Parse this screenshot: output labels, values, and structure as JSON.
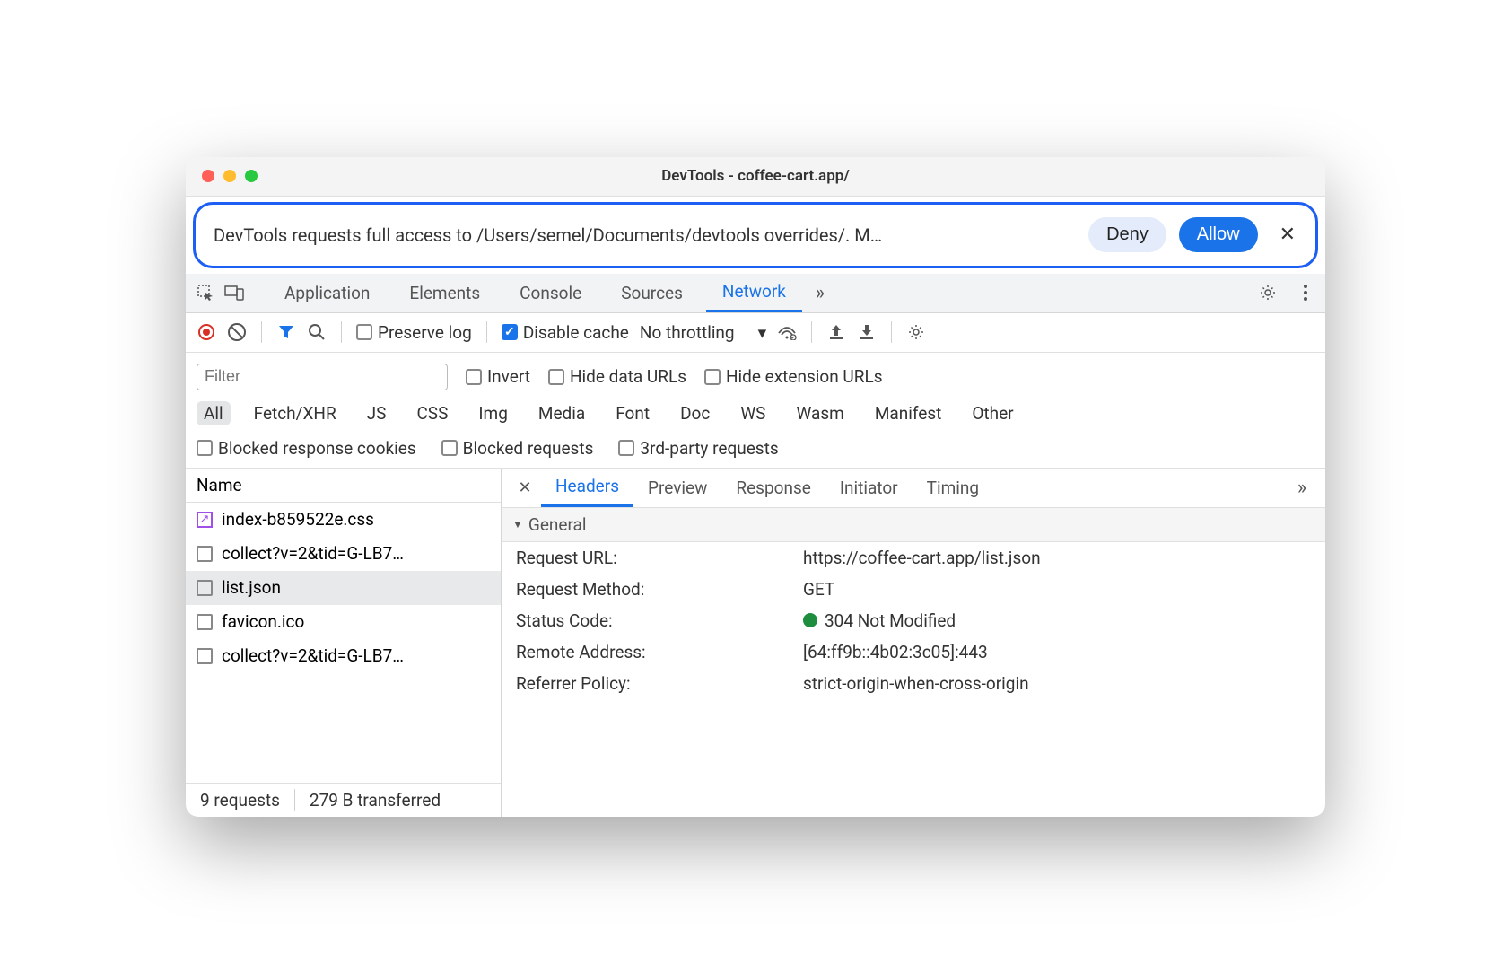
{
  "title": "DevTools - coffee-cart.app/",
  "permission": {
    "message": "DevTools requests full access to /Users/semel/Documents/devtools overrides/. M…",
    "deny": "Deny",
    "allow": "Allow"
  },
  "mainTabs": [
    "Application",
    "Elements",
    "Console",
    "Sources",
    "Network"
  ],
  "mainTabActive": "Network",
  "toolbar": {
    "preserve_log": "Preserve log",
    "disable_cache": "Disable cache",
    "throttling": "No throttling"
  },
  "filter": {
    "placeholder": "Filter",
    "invert": "Invert",
    "hide_data_urls": "Hide data URLs",
    "hide_ext_urls": "Hide extension URLs",
    "types": [
      "All",
      "Fetch/XHR",
      "JS",
      "CSS",
      "Img",
      "Media",
      "Font",
      "Doc",
      "WS",
      "Wasm",
      "Manifest",
      "Other"
    ],
    "blocked_cookies": "Blocked response cookies",
    "blocked_requests": "Blocked requests",
    "third_party": "3rd-party requests"
  },
  "nameHeader": "Name",
  "files": [
    {
      "name": "index-b859522e.css",
      "type": "css"
    },
    {
      "name": "collect?v=2&tid=G-LB7…",
      "type": "req"
    },
    {
      "name": "list.json",
      "type": "req",
      "selected": true
    },
    {
      "name": "favicon.ico",
      "type": "req"
    },
    {
      "name": "collect?v=2&tid=G-LB7…",
      "type": "req"
    }
  ],
  "status": {
    "requests": "9 requests",
    "transferred": "279 B transferred"
  },
  "detailTabs": [
    "Headers",
    "Preview",
    "Response",
    "Initiator",
    "Timing"
  ],
  "detailTabActive": "Headers",
  "general": {
    "title": "General",
    "rows": [
      {
        "k": "Request URL:",
        "v": "https://coffee-cart.app/list.json"
      },
      {
        "k": "Request Method:",
        "v": "GET"
      },
      {
        "k": "Status Code:",
        "v": "304 Not Modified",
        "dot": true
      },
      {
        "k": "Remote Address:",
        "v": "[64:ff9b::4b02:3c05]:443"
      },
      {
        "k": "Referrer Policy:",
        "v": "strict-origin-when-cross-origin"
      }
    ]
  }
}
